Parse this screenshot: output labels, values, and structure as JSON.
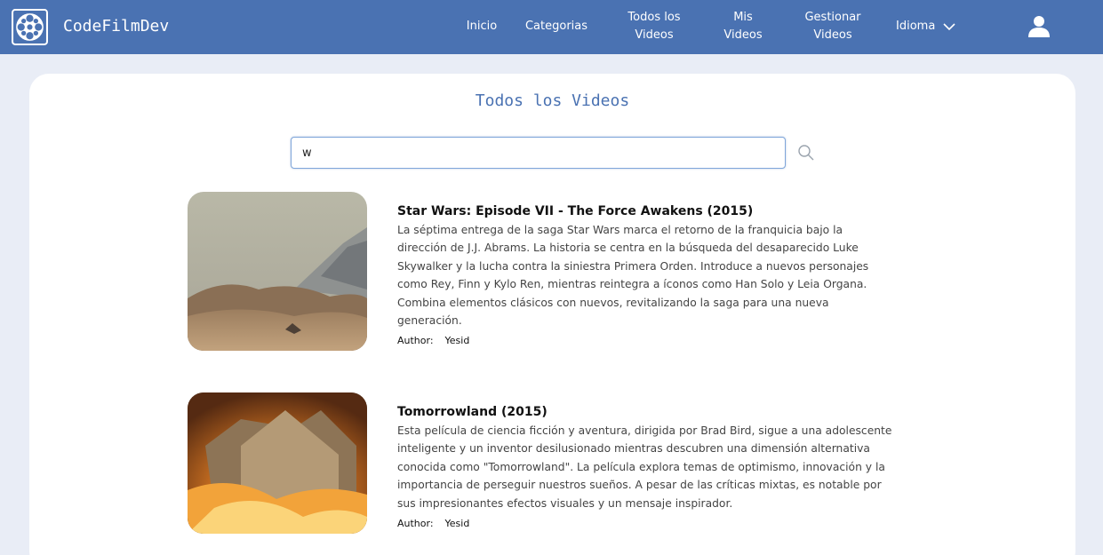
{
  "header": {
    "brand": "CodeFilmDev",
    "nav": {
      "inicio": "Inicio",
      "categorias": "Categorias",
      "todos_line1": "Todos los",
      "todos_line2": "Videos",
      "mis_line1": "Mis",
      "mis_line2": "Videos",
      "gestionar_line1": "Gestionar",
      "gestionar_line2": "Videos",
      "idioma": "Idioma"
    },
    "color": "#4a72b2"
  },
  "main": {
    "title": "Todos los Videos",
    "search": {
      "value": "w",
      "icon": "search-icon"
    }
  },
  "videos": [
    {
      "title": "Star Wars: Episode VII - The Force Awakens (2015)",
      "description": "La séptima entrega de la saga Star Wars marca el retorno de la franquicia bajo la dirección de J.J. Abrams. La historia se centra en la búsqueda del desaparecido Luke Skywalker y la lucha contra la siniestra Primera Orden. Introduce a nuevos personajes como Rey, Finn y Kylo Ren, mientras reintegra a íconos como Han Solo y Leia Organa. Combina elementos clásicos con nuevos, revitalizando la saga para una nueva generación.",
      "author_label": "Author:",
      "author": "Yesid"
    },
    {
      "title": "Tomorrowland (2015)",
      "description": "Esta película de ciencia ficción y aventura, dirigida por Brad Bird, sigue a una adolescente inteligente y un inventor desilusionado mientras descubren una dimensión alternativa conocida como \"Tomorrowland\". La película explora temas de optimismo, innovación y la importancia de perseguir nuestros sueños. A pesar de las críticas mixtas, es notable por sus impresionantes efectos visuales y un mensaje inspirador.",
      "author_label": "Author:",
      "author": "Yesid"
    }
  ]
}
